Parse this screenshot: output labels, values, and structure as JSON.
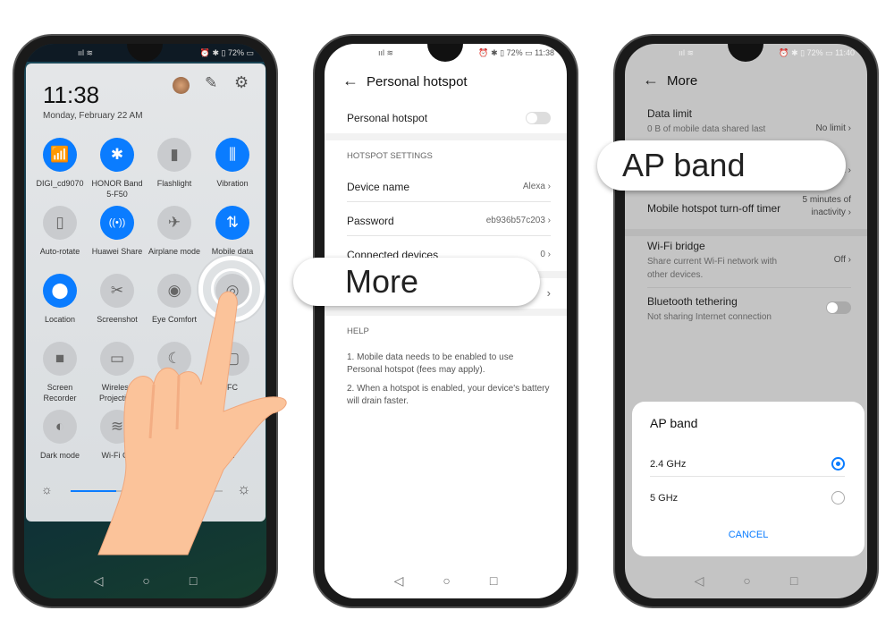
{
  "colors": {
    "accent": "#0a7cff",
    "panel": "#dfe2e5",
    "skin": "#fbc39a"
  },
  "phone1": {
    "status": {
      "left": "ııl ≋",
      "right": "⏰ ✱ ▯ 72% ▭"
    },
    "time": "11:38",
    "date": "Monday, February 22  AM",
    "header_icons": [
      "avatar",
      "pencil-icon",
      "gear-icon"
    ],
    "tiles": [
      {
        "label": "DIGI_cd9070",
        "icon": "wifi-icon",
        "glyph": "📶",
        "on": true
      },
      {
        "label": "HONOR Band 5-F50",
        "icon": "bluetooth-icon",
        "glyph": "✱",
        "on": true
      },
      {
        "label": "Flashlight",
        "icon": "flashlight-icon",
        "glyph": "▮",
        "on": false
      },
      {
        "label": "Vibration",
        "icon": "vibration-icon",
        "glyph": "⫼",
        "on": true
      },
      {
        "label": "Auto-rotate",
        "icon": "auto-rotate-icon",
        "glyph": "▯",
        "on": false
      },
      {
        "label": "Huawei Share",
        "icon": "huawei-share-icon",
        "glyph": "((•))",
        "on": true
      },
      {
        "label": "Airplane mode",
        "icon": "airplane-icon",
        "glyph": "✈",
        "on": false
      },
      {
        "label": "Mobile data",
        "icon": "mobile-data-icon",
        "glyph": "⇅",
        "on": true
      },
      {
        "label": "Location",
        "icon": "location-icon",
        "glyph": "⬤",
        "on": true
      },
      {
        "label": "Screenshot",
        "icon": "screenshot-icon",
        "glyph": "✂",
        "on": false
      },
      {
        "label": "Eye Comfort",
        "icon": "eye-icon",
        "glyph": "◉",
        "on": false
      },
      {
        "label": "ot",
        "icon": "hotspot-icon",
        "glyph": "◎",
        "on": false
      },
      {
        "label": "Screen Recorder",
        "icon": "screen-recorder-icon",
        "glyph": "■",
        "on": false
      },
      {
        "label": "Wireless Projection",
        "icon": "wireless-projection-icon",
        "glyph": "▭",
        "on": false
      },
      {
        "label": "",
        "icon": "moon-icon",
        "glyph": "☾",
        "on": false
      },
      {
        "label": "FC",
        "icon": "nfc-icon",
        "glyph": "▢",
        "on": false
      },
      {
        "label": "Dark mode",
        "icon": "dark-mode-icon",
        "glyph": "◐",
        "on": false
      },
      {
        "label": "Wi-Fi Ca",
        "icon": "wifi-calling-icon",
        "glyph": "≋",
        "on": false
      },
      {
        "label": "",
        "icon": "unknown-icon",
        "glyph": "",
        "on": false
      },
      {
        "label": "n",
        "icon": "document-icon",
        "glyph": "▤",
        "on": false
      }
    ],
    "brightness": 0.3,
    "nav": [
      "◁",
      "○",
      "□"
    ]
  },
  "phone2": {
    "status": {
      "left": "ııl ≋",
      "right": "⏰ ✱ ▯ 72% ▭ 11:38"
    },
    "title": "Personal hotspot",
    "toggle_label": "Personal hotspot",
    "section": "HOTSPOT SETTINGS",
    "rows": [
      {
        "label": "Device name",
        "value": "Alexa"
      },
      {
        "label": "Password",
        "value": "eb936b57c203"
      },
      {
        "label": "Connected devices",
        "value": "0"
      }
    ],
    "callout": "More",
    "help_title": "HELP",
    "help": [
      "1. Mobile data needs to be enabled to use Personal hotspot (fees may apply).",
      "2. When a hotspot is enabled, your device's battery will drain faster."
    ],
    "nav": [
      "◁",
      "○",
      "□"
    ]
  },
  "phone3": {
    "status": {
      "left": "ııl ≋",
      "right": "⏰ ✱ ▯ 72% ▭ 11:40"
    },
    "title": "More",
    "data_limit": {
      "label": "Data limit",
      "sub": "0 B of mobile data shared last",
      "value": "No limit"
    },
    "ap_band_value": "z",
    "timer": {
      "label": "Mobile hotspot turn-off timer",
      "value": "5 minutes of inactivity"
    },
    "wifi_bridge": {
      "label": "Wi-Fi bridge",
      "sub": "Share current Wi-Fi network with other devices.",
      "value": "Off"
    },
    "bt": {
      "label": "Bluetooth tethering",
      "sub": "Not sharing Internet connection"
    },
    "callout": "AP band",
    "dialog": {
      "title": "AP band",
      "options": [
        {
          "label": "2.4 GHz",
          "selected": true
        },
        {
          "label": "5 GHz",
          "selected": false
        }
      ],
      "cancel": "CANCEL"
    },
    "nav": [
      "◁",
      "○",
      "□"
    ]
  }
}
